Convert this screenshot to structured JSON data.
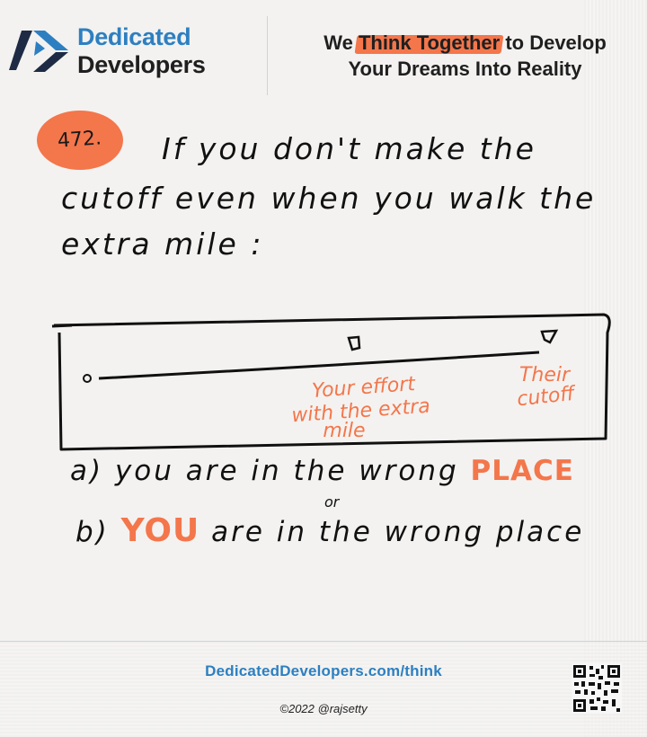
{
  "header": {
    "brand_line1": "Dedicated",
    "brand_line2": "Developers",
    "tagline_prefix": "We ",
    "tagline_highlight": "Think Together",
    "tagline_suffix": " to Develop",
    "tagline_line2": "Your Dreams Into Reality"
  },
  "note": {
    "number": "472.",
    "title_lines": [
      "If  you  don't  make  the",
      "cutoff  even  when  you  walk  the",
      "extra  mile :"
    ]
  },
  "diagram": {
    "effort_label_lines": [
      "Your effort",
      "with the extra",
      "mile"
    ],
    "cutoff_label_lines": [
      "Their",
      "cutoff"
    ]
  },
  "options": {
    "a_prefix": "a)  you  are  in  the  wrong  ",
    "a_emphasis": "PLACE",
    "or": "or",
    "b_prefix": "b)  ",
    "b_emphasis": "YOU",
    "b_suffix": "  are  in  the  wrong  place"
  },
  "footer": {
    "url": "DedicatedDevelopers.com/think",
    "copyright": "©2022 @rajsetty"
  },
  "colors": {
    "accent_orange": "#f4764b",
    "brand_blue": "#2d7fc1",
    "ink": "#111111"
  }
}
